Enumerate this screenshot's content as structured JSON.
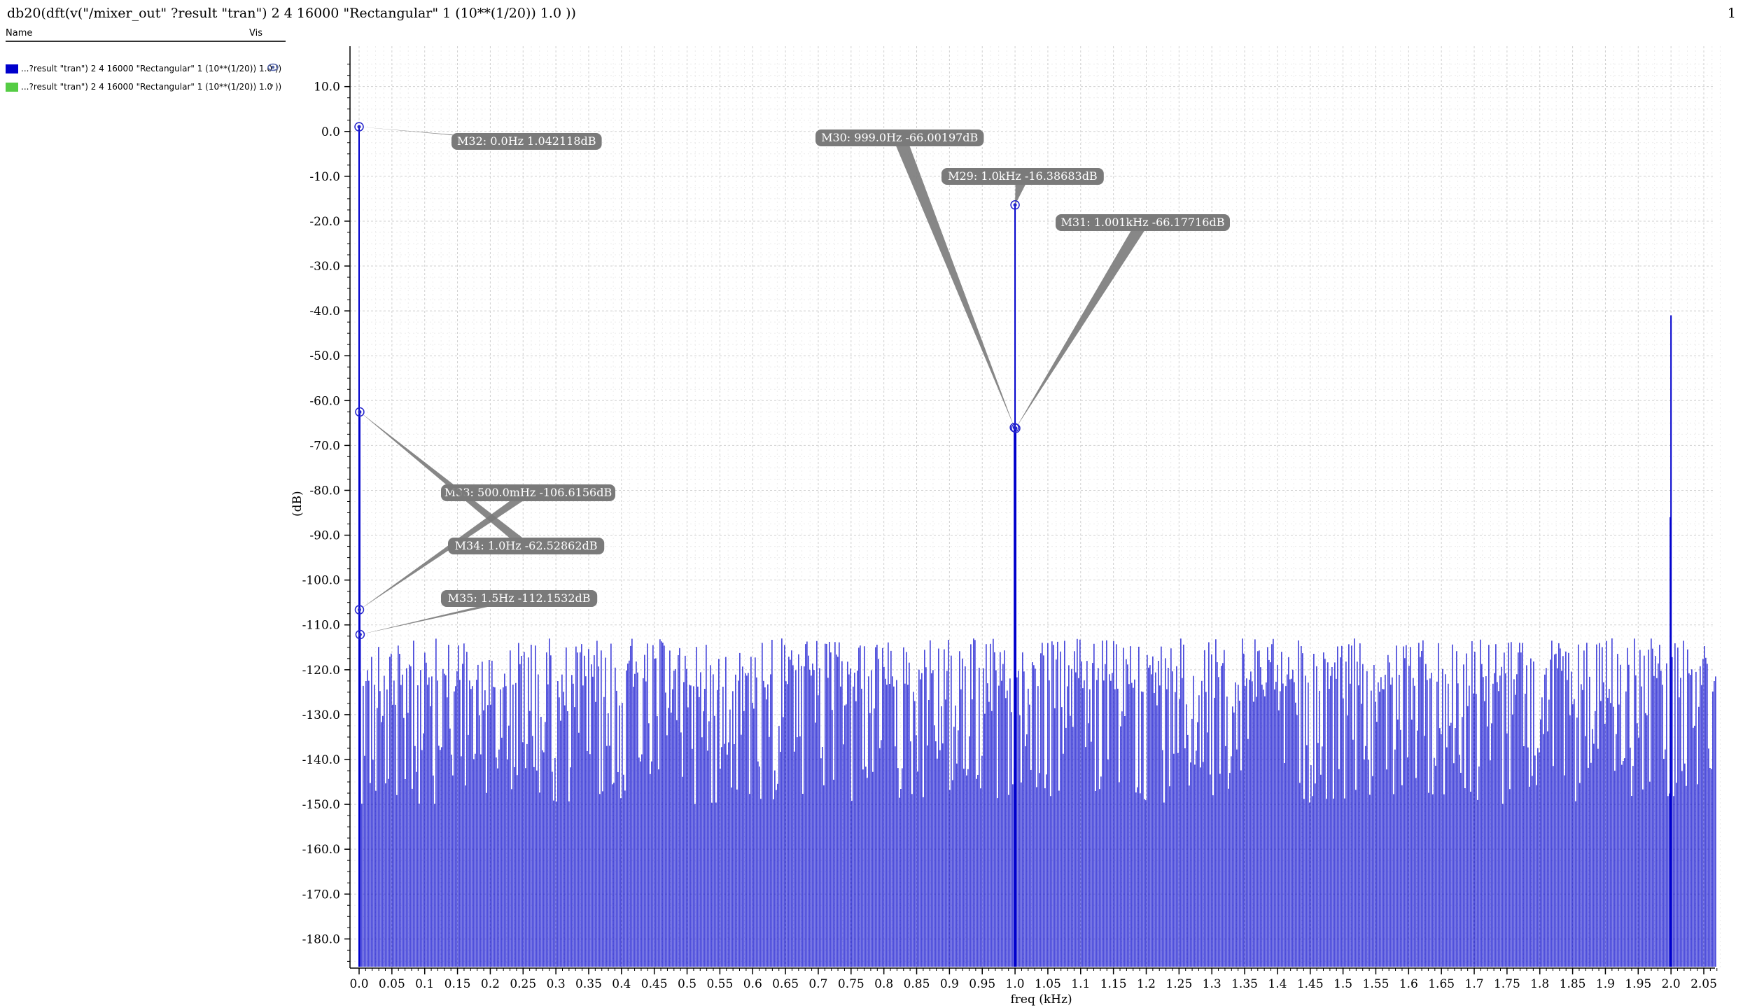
{
  "header": {
    "title": "db20(dft(v(\"/mixer_out\" ?result \"tran\") 2 4 16000 \"Rectangular\" 1 (10**(1/20)) 1.0 ))",
    "page_number": "1"
  },
  "legend": {
    "col_name": "Name",
    "col_vis": "Vis",
    "items": [
      {
        "label": "...?result \"tran\") 2 4 16000 \"Rectangular\" 1 (10**(1/20)) 1.0 ))",
        "color": "#0000cc",
        "vis_icon": "eye-icon"
      },
      {
        "label": "...?result \"tran\") 2 4 16000 \"Rectangular\" 1 (10**(1/20)) 1.0 ))",
        "color": "#55cc44",
        "vis_icon": "dot-icon"
      }
    ]
  },
  "chart_data": {
    "type": "bar",
    "xlabel": "freq (kHz)",
    "ylabel": "(dB)",
    "xlim": [
      0.0,
      2.075
    ],
    "ylim": [
      -186.5,
      19.0
    ],
    "x_ticks": [
      "0.0",
      "0.05",
      "0.1",
      "0.15",
      "0.2",
      "0.25",
      "0.3",
      "0.35",
      "0.4",
      "0.45",
      "0.5",
      "0.55",
      "0.6",
      "0.65",
      "0.7",
      "0.75",
      "0.8",
      "0.85",
      "0.9",
      "0.95",
      "1.0",
      "1.05",
      "1.1",
      "1.15",
      "1.2",
      "1.25",
      "1.3",
      "1.35",
      "1.4",
      "1.45",
      "1.5",
      "1.55",
      "1.6",
      "1.65",
      "1.7",
      "1.75",
      "1.8",
      "1.85",
      "1.9",
      "1.95",
      "2.0",
      "2.05"
    ],
    "y_ticks": [
      "10.0",
      "0.0",
      "-10.0",
      "-20.0",
      "-30.0",
      "-40.0",
      "-50.0",
      "-60.0",
      "-70.0",
      "-80.0",
      "-90.0",
      "-100.0",
      "-110.0",
      "-120.0",
      "-130.0",
      "-140.0",
      "-150.0",
      "-160.0",
      "-170.0",
      "-180.0"
    ],
    "grid": true,
    "series": [
      {
        "color": "#0000cc",
        "noise_floor_db": [
          -113,
          -140
        ],
        "spikes": [
          {
            "x": 0.0,
            "y": 1.042118
          },
          {
            "x": 0.0005,
            "y": -106.6156
          },
          {
            "x": 0.001,
            "y": -62.52862
          },
          {
            "x": 0.0015,
            "y": -112.1532
          },
          {
            "x": 0.999,
            "y": -66.00197
          },
          {
            "x": 1.0,
            "y": -16.38683
          },
          {
            "x": 1.001,
            "y": -66.17716
          },
          {
            "x": 2.0,
            "y": -41.0
          },
          {
            "x": 1.999,
            "y": -86.0
          }
        ]
      }
    ],
    "markers": [
      {
        "label": "M32: 0.0Hz 1.042118dB",
        "x": 0.0,
        "y": 1.042118
      },
      {
        "label": "M30: 999.0Hz -66.00197dB",
        "x": 0.999,
        "y": -66.00197
      },
      {
        "label": "M29: 1.0kHz -16.38683dB",
        "x": 1.0,
        "y": -16.38683
      },
      {
        "label": "M31: 1.001kHz -66.17716dB",
        "x": 1.001,
        "y": -66.17716
      },
      {
        "label": "M33: 500.0mHz -106.6156dB",
        "x": 0.0005,
        "y": -106.6156
      },
      {
        "label": "M34: 1.0Hz -62.52862dB",
        "x": 0.001,
        "y": -62.52862
      },
      {
        "label": "M35: 1.5Hz -112.1532dB",
        "x": 0.0015,
        "y": -112.1532
      }
    ]
  }
}
